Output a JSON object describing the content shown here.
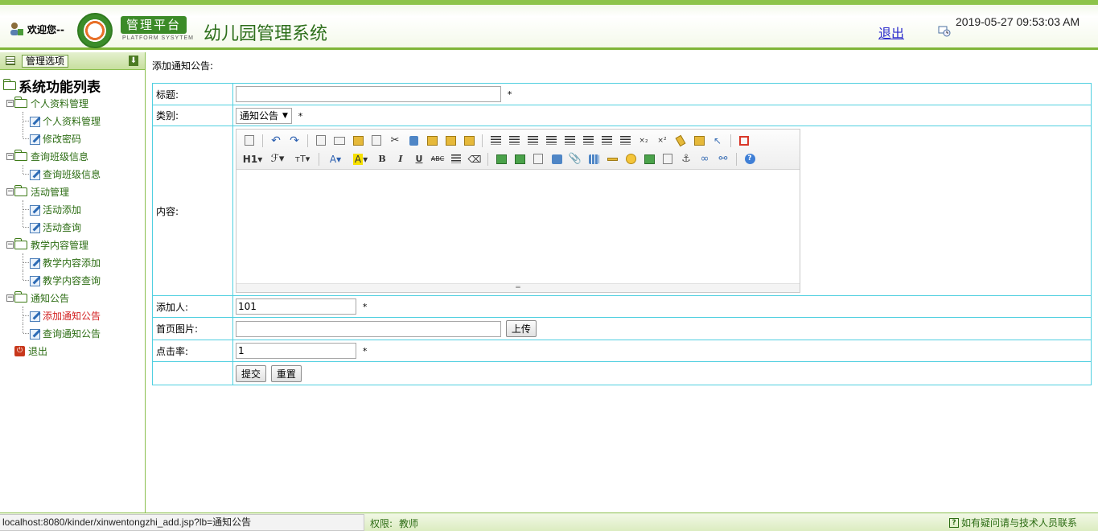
{
  "header": {
    "welcome": "欢迎您--",
    "brand": "管理平台",
    "brand_sub": "PLATFORM SYSYTEM",
    "system_title": "幼儿园管理系统",
    "logout": "退出",
    "datetime": "2019-05-27 09:53:03 AM"
  },
  "sidebar": {
    "options_label": "管理选项",
    "root": "系统功能列表",
    "groups": [
      {
        "label": "个人资料管理",
        "items": [
          "个人资料管理",
          "修改密码"
        ]
      },
      {
        "label": "查询班级信息",
        "items": [
          "查询班级信息"
        ]
      },
      {
        "label": "活动管理",
        "items": [
          "活动添加",
          "活动查询"
        ]
      },
      {
        "label": "教学内容管理",
        "items": [
          "教学内容添加",
          "教学内容查询"
        ]
      },
      {
        "label": "通知公告",
        "items": [
          "添加通知公告",
          "查询通知公告"
        ]
      }
    ],
    "exit": "退出"
  },
  "main": {
    "crumb": "添加通知公告:",
    "form": {
      "title_label": "标题:",
      "title_value": "",
      "category_label": "类别:",
      "category_value": "通知公告",
      "content_label": "内容:",
      "author_label": "添加人:",
      "author_value": "101",
      "image_label": "首页图片:",
      "image_value": "",
      "upload_button": "上传",
      "clicks_label": "点击率:",
      "clicks_value": "1",
      "required_mark": "*",
      "submit_button": "提交",
      "reset_button": "重置"
    },
    "editor": {
      "h1": "H1",
      "font": "ℱ",
      "size": "тT",
      "forecolor": "A",
      "hilite": "A",
      "bold": "B",
      "italic": "I",
      "underline": "U",
      "strike": "ABC",
      "sub": "×₂",
      "sup": "×²",
      "help": "?"
    }
  },
  "status": {
    "url": "localhost:8080/kinder/xinwentongzhi_add.jsp?lb=通知公告",
    "permission_label": "权限:",
    "permission_value": "教师",
    "help_note": "如有疑问请与技术人员联系"
  }
}
